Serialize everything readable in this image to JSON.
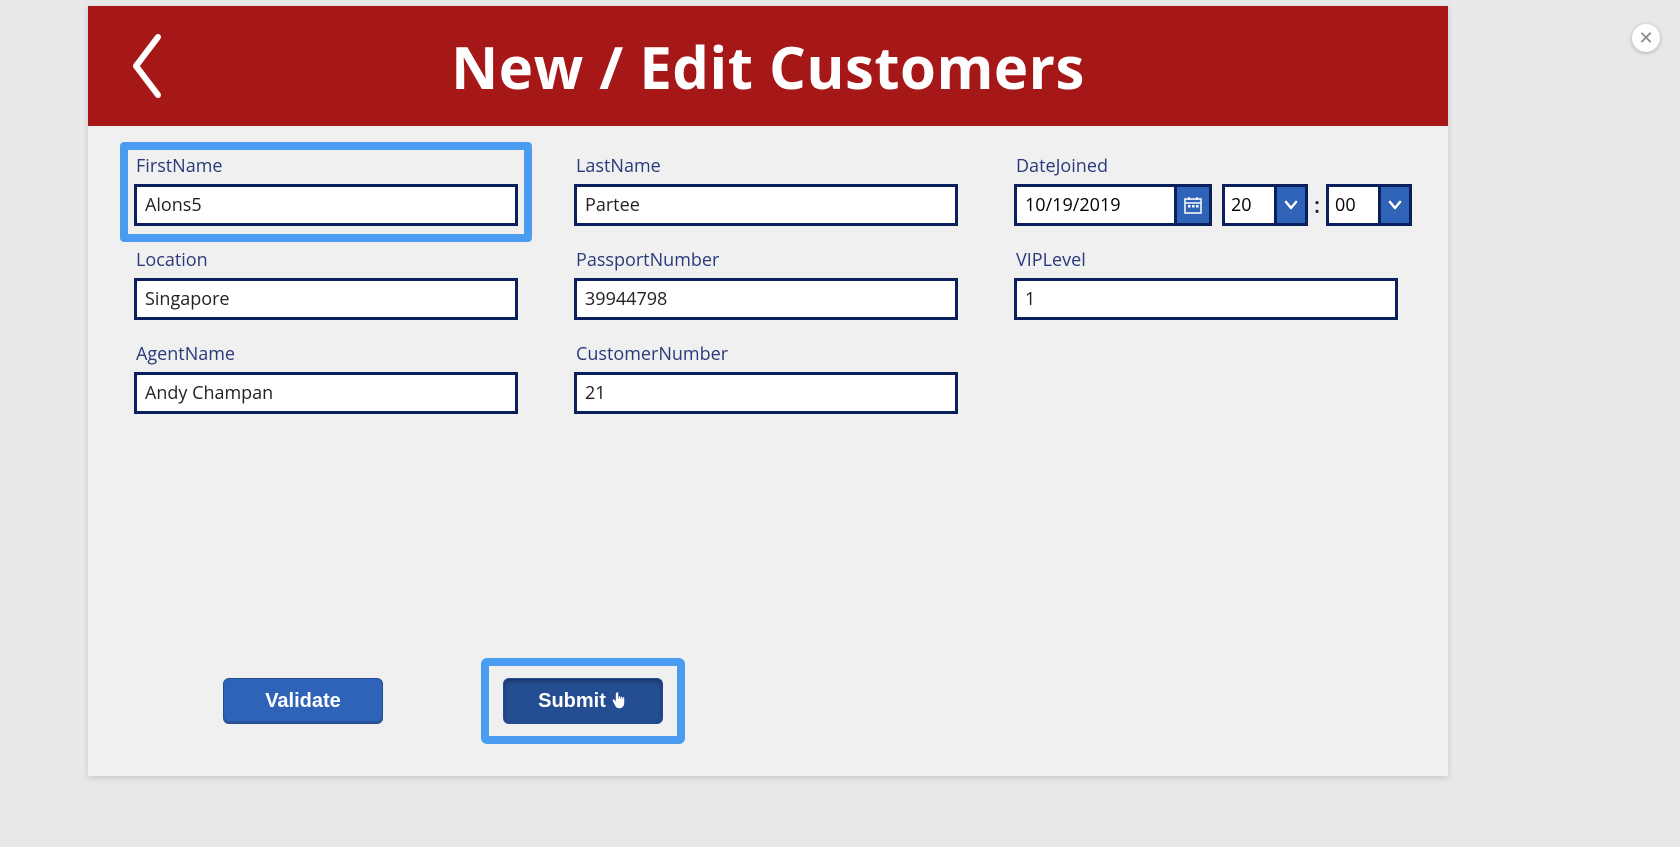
{
  "header": {
    "title": "New / Edit Customers"
  },
  "fields": {
    "firstName": {
      "label": "FirstName",
      "value": "Alons5"
    },
    "lastName": {
      "label": "LastName",
      "value": "Partee"
    },
    "dateJoined": {
      "label": "DateJoined",
      "date": "10/19/2019",
      "hour": "20",
      "minute": "00",
      "separator": ":"
    },
    "location": {
      "label": "Location",
      "value": "Singapore"
    },
    "passportNumber": {
      "label": "PassportNumber",
      "value": "39944798"
    },
    "vipLevel": {
      "label": "VIPLevel",
      "value": "1"
    },
    "agentName": {
      "label": "AgentName",
      "value": "Andy Champan"
    },
    "customerNumber": {
      "label": "CustomerNumber",
      "value": "21"
    }
  },
  "buttons": {
    "validate": "Validate",
    "submit": "Submit"
  },
  "close": "✕"
}
